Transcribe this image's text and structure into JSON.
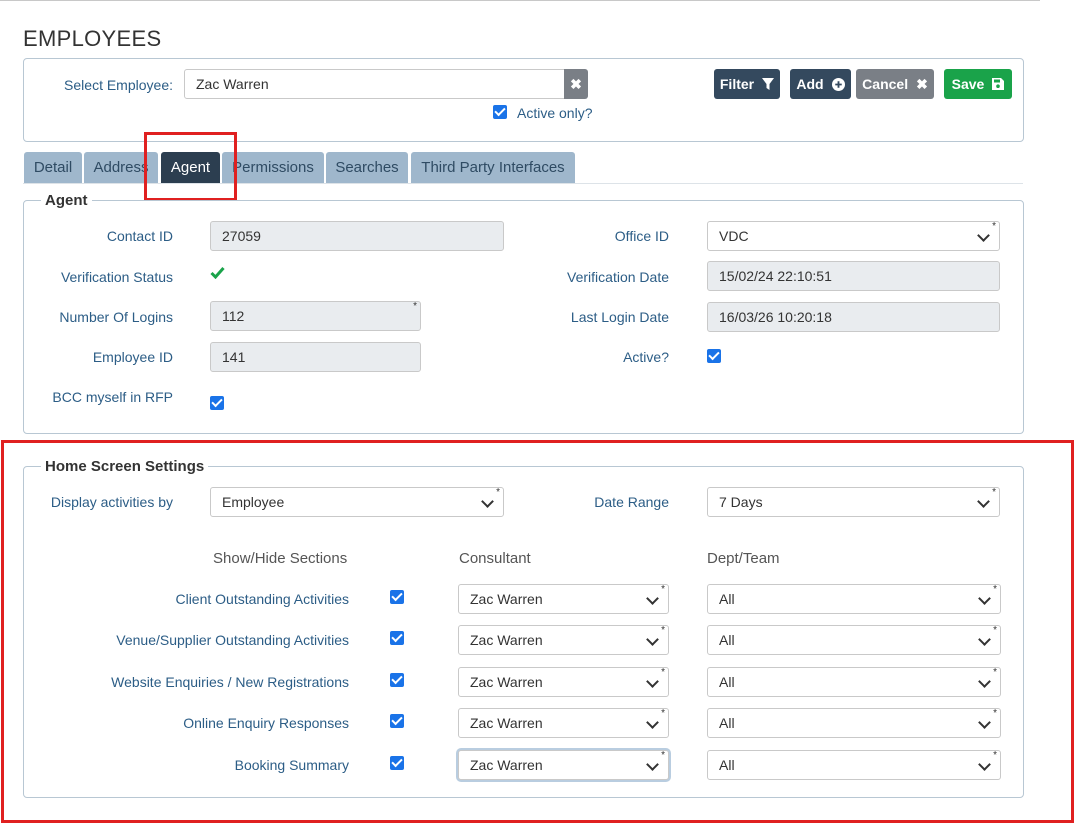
{
  "page": {
    "title": "EMPLOYEES"
  },
  "select_employee": {
    "label": "Select Employee:",
    "value": "Zac Warren",
    "active_only_label": "Active only?",
    "active_only_checked": true
  },
  "toolbar": {
    "filter_label": "Filter",
    "add_label": "Add",
    "cancel_label": "Cancel",
    "save_label": "Save"
  },
  "tabs": [
    {
      "label": "Detail",
      "active": false
    },
    {
      "label": "Address",
      "active": false
    },
    {
      "label": "Agent",
      "active": true
    },
    {
      "label": "Permissions",
      "active": false
    },
    {
      "label": "Searches",
      "active": false
    },
    {
      "label": "Third Party Interfaces",
      "active": false
    }
  ],
  "agent": {
    "legend": "Agent",
    "contact_id": {
      "label": "Contact ID",
      "value": "27059"
    },
    "verification_status": {
      "label": "Verification Status",
      "verified": true
    },
    "number_of_logins": {
      "label": "Number Of Logins",
      "value": "112"
    },
    "employee_id": {
      "label": "Employee ID",
      "value": "141"
    },
    "bcc_myself": {
      "label": "BCC myself in RFP",
      "checked": true
    },
    "office_id": {
      "label": "Office ID",
      "value": "VDC"
    },
    "verification_date": {
      "label": "Verification Date",
      "value": "15/02/24 22:10:51"
    },
    "last_login_date": {
      "label": "Last Login Date",
      "value": "16/03/26 10:20:18"
    },
    "active": {
      "label": "Active?",
      "checked": true
    }
  },
  "home_screen": {
    "legend": "Home Screen Settings",
    "display_activities": {
      "label": "Display activities by",
      "value": "Employee"
    },
    "date_range": {
      "label": "Date Range",
      "value": "7 Days"
    },
    "headers": {
      "show_hide": "Show/Hide Sections",
      "consultant": "Consultant",
      "dept_team": "Dept/Team"
    },
    "rows": [
      {
        "label": "Client Outstanding Activities",
        "checked": true,
        "consultant": "Zac Warren",
        "dept": "All"
      },
      {
        "label": "Venue/Supplier Outstanding Activities",
        "checked": true,
        "consultant": "Zac Warren",
        "dept": "All"
      },
      {
        "label": "Website Enquiries / New Registrations",
        "checked": true,
        "consultant": "Zac Warren",
        "dept": "All"
      },
      {
        "label": "Online Enquiry Responses",
        "checked": true,
        "consultant": "Zac Warren",
        "dept": "All"
      },
      {
        "label": "Booking Summary",
        "checked": true,
        "consultant": "Zac Warren",
        "dept": "All"
      }
    ]
  },
  "colors": {
    "accent": "#34495e",
    "save": "#1aa34a",
    "highlight": "#e02020",
    "label": "#2c5d86"
  }
}
